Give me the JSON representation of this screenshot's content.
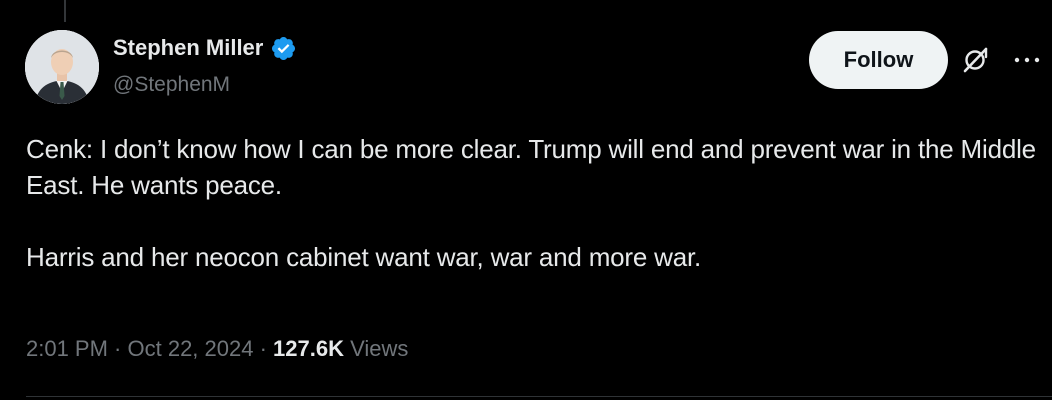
{
  "author": {
    "display_name": "Stephen Miller",
    "handle": "@StephenM",
    "verified": true,
    "avatar_icon": "profile-photo"
  },
  "actions": {
    "follow_label": "Follow",
    "grok_icon": "grok-icon",
    "more_icon": "more-horizontal-icon"
  },
  "tweet": {
    "text": "Cenk: I don’t know how I can be more clear. Trump will end and prevent war in the Middle East. He wants peace.\n\nHarris and her neocon cabinet want war, war and more war."
  },
  "meta": {
    "time": "2:01 PM",
    "separator_1": " · ",
    "date": "Oct 22, 2024",
    "separator_2": " · ",
    "views_count": "127.6K",
    "views_label": " Views"
  },
  "colors": {
    "background": "#000000",
    "text_primary": "#e7e9ea",
    "text_secondary": "#71767b",
    "verified_blue": "#1d9bf0",
    "follow_bg": "#eff3f4"
  }
}
